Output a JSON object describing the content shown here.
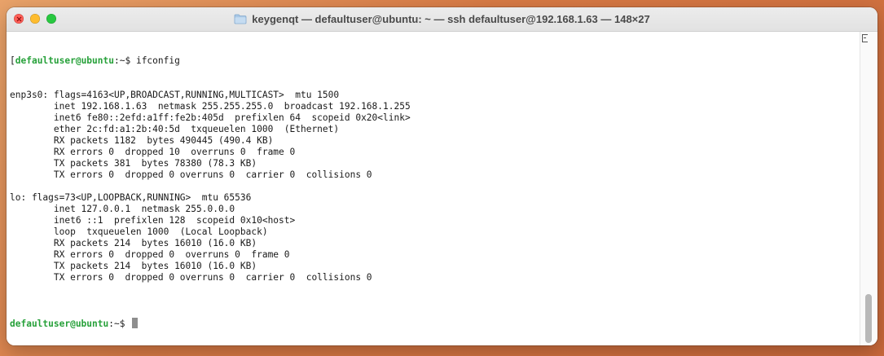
{
  "window": {
    "title": "keygenqt — defaultuser@ubuntu: ~ — ssh defaultuser@192.168.1.63 — 148×27"
  },
  "icons": {
    "close": "close-icon",
    "minimize": "minimize-icon",
    "maximize": "maximize-icon",
    "folder": "folder-icon"
  },
  "colors": {
    "close": "#fe5f57",
    "minimize": "#febc2e",
    "maximize": "#28c840",
    "prompt": "#27a13a"
  },
  "terminal": {
    "prompt_user": "defaultuser@ubuntu",
    "prompt_suffix": ":~$ ",
    "first_prompt_open": "[",
    "command": "ifconfig",
    "output": [
      "enp3s0: flags=4163<UP,BROADCAST,RUNNING,MULTICAST>  mtu 1500",
      "        inet 192.168.1.63  netmask 255.255.255.0  broadcast 192.168.1.255",
      "        inet6 fe80::2efd:a1ff:fe2b:405d  prefixlen 64  scopeid 0x20<link>",
      "        ether 2c:fd:a1:2b:40:5d  txqueuelen 1000  (Ethernet)",
      "        RX packets 1182  bytes 490445 (490.4 KB)",
      "        RX errors 0  dropped 10  overruns 0  frame 0",
      "        TX packets 381  bytes 78380 (78.3 KB)",
      "        TX errors 0  dropped 0 overruns 0  carrier 0  collisions 0",
      "",
      "lo: flags=73<UP,LOOPBACK,RUNNING>  mtu 65536",
      "        inet 127.0.0.1  netmask 255.0.0.0",
      "        inet6 ::1  prefixlen 128  scopeid 0x10<host>",
      "        loop  txqueuelen 1000  (Local Loopback)",
      "        RX packets 214  bytes 16010 (16.0 KB)",
      "        RX errors 0  dropped 0  overruns 0  frame 0",
      "        TX packets 214  bytes 16010 (16.0 KB)",
      "        TX errors 0  dropped 0 overruns 0  carrier 0  collisions 0",
      ""
    ]
  }
}
